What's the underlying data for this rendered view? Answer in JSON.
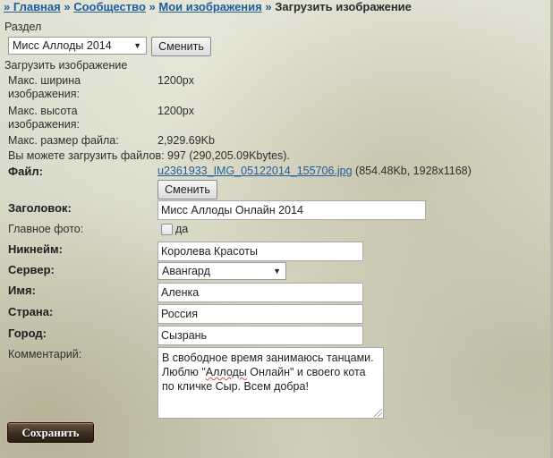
{
  "breadcrumb": {
    "home_prefix": "»",
    "home": "Главная",
    "sep1": "»",
    "community": "Сообщество",
    "sep2": "»",
    "my_images": "Мои изображения",
    "sep3": "»",
    "current": "Загрузить изображение"
  },
  "section": {
    "label": "Раздел",
    "selected": "Мисс Аллоды 2014",
    "change_button": "Сменить"
  },
  "upload": {
    "heading": "Загрузить изображение",
    "max_width_label": "Макс. ширина изображения:",
    "max_width_value": "1200px",
    "max_height_label": "Макс. высота изображения:",
    "max_height_value": "1200px",
    "max_size_label": "Макс. размер файла:",
    "max_size_value": "2,929.69Kb",
    "quota_text": "Вы можете загрузить файлов: 997 (290,205.09Kbytes)."
  },
  "file": {
    "label": "Файл:",
    "name": "u2361933_IMG_05122014_155706.jpg",
    "info": "(854.48Kb, 1928x1168)",
    "change_button": "Сменить"
  },
  "form": {
    "title_label": "Заголовок:",
    "title_value": "Мисс Аллоды Онлайн 2014",
    "main_photo_label": "Главное фото:",
    "main_photo_option": "да",
    "main_photo_checked": false,
    "nickname_label": "Никнейм:",
    "nickname_value": "Королева Красоты",
    "server_label": "Сервер:",
    "server_value": "Авангард",
    "name_label": "Имя:",
    "name_value": "Аленка",
    "country_label": "Страна:",
    "country_value": "Россия",
    "city_label": "Город:",
    "city_value": "Сызрань",
    "comment_label": "Комментарий:",
    "comment_line1": "В свободное время занимаюсь танцами.",
    "comment_line2_a": "Люблю \"",
    "comment_line2_b": "Аллоды",
    "comment_line2_c": " Онлайн\" и своего кота",
    "comment_line3": "по кличке Сыр. Всем добра!",
    "save_button": "Сохранить"
  },
  "icons": {
    "dropdown": "chevron-down-icon",
    "resize": "resize-grip-icon"
  }
}
